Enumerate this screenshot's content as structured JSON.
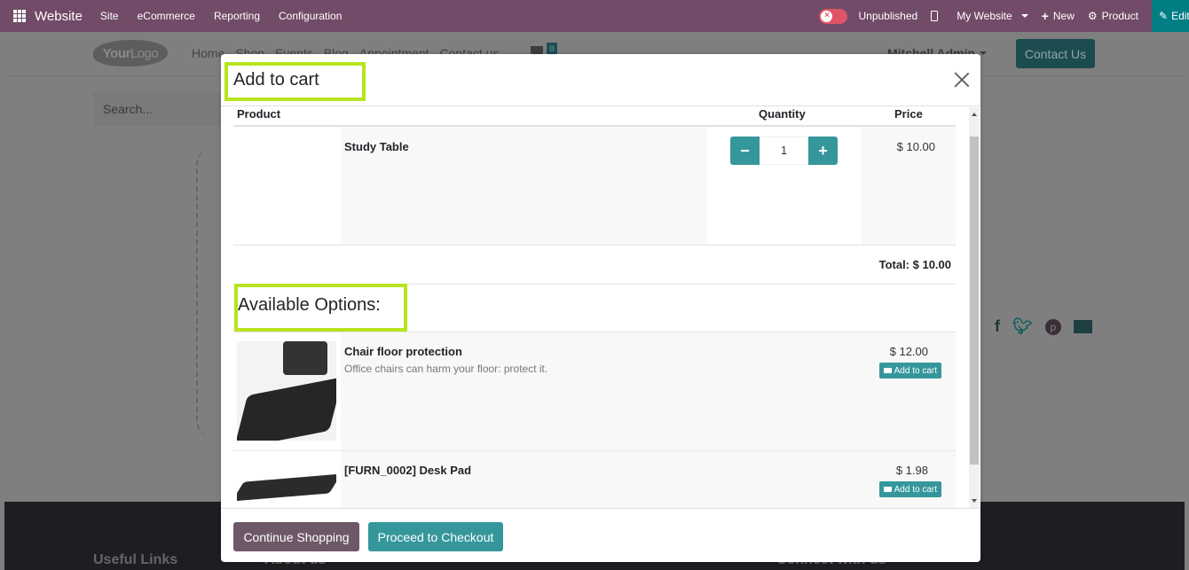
{
  "topbar": {
    "brand": "Website",
    "menus": [
      "Site",
      "eCommerce",
      "Reporting",
      "Configuration"
    ],
    "publish_status": "Unpublished",
    "website_selector": "My Website",
    "new_label": "New",
    "product_label": "Product",
    "edit_label": "Edit",
    "icons": {
      "apps": "grid-icon",
      "unpublished": "toggle-off-icon",
      "mobile": "mobile-icon",
      "new": "plus-icon",
      "product": "gear-icon",
      "edit": "pencil-icon"
    }
  },
  "site": {
    "logo_bold": "Your",
    "logo_light": "Logo",
    "nav": [
      "Home",
      "Shop",
      "Events",
      "Blog",
      "Appointment",
      "Contact us"
    ],
    "cart_count": "0",
    "user": "Mitchell Admin",
    "contact_button": "Contact Us",
    "search_placeholder": "Search...",
    "social_icons": [
      "facebook-icon",
      "twitter-icon",
      "pinterest-icon",
      "envelope-icon"
    ],
    "footer_columns": [
      "Useful Links",
      "About us",
      "Connect with us"
    ]
  },
  "modal": {
    "title": "Add to cart",
    "columns": {
      "product": "Product",
      "quantity": "Quantity",
      "price": "Price"
    },
    "main_product": {
      "name": "Study Table",
      "quantity": "1",
      "price": "$ 10.00"
    },
    "total": "Total: $ 10.00",
    "options_title": "Available Options:",
    "options": [
      {
        "name": "Chair floor protection",
        "description": "Office chairs can harm your floor: protect it.",
        "price": "$ 12.00",
        "button": "Add to cart"
      },
      {
        "name": "[FURN_0002] Desk Pad",
        "description": "",
        "price": "$ 1.98",
        "button": "Add to cart"
      }
    ],
    "footer": {
      "continue": "Continue Shopping",
      "checkout": "Proceed to Checkout"
    }
  },
  "colors": {
    "admin_bar": "#714b67",
    "accent": "#35979c",
    "highlight": "#b7e41d",
    "continue_btn": "#6e5868"
  }
}
